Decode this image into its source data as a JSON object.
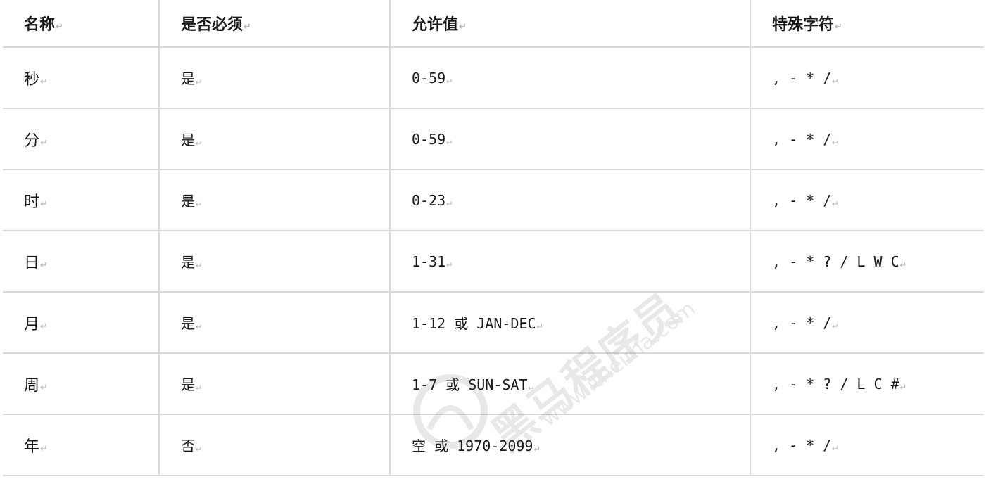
{
  "table": {
    "headers": [
      "名称",
      "是否必须",
      "允许值",
      "特殊字符"
    ],
    "rows": [
      [
        "秒",
        "是",
        "0-59",
        ", - * /"
      ],
      [
        "分",
        "是",
        "0-59",
        ", - * /"
      ],
      [
        "时",
        "是",
        "0-23",
        ", - * /"
      ],
      [
        "日",
        "是",
        "1-31",
        ", - * ? / L W C"
      ],
      [
        "月",
        "是",
        "1-12 或 JAN-DEC",
        ", - * /"
      ],
      [
        "周",
        "是",
        "1-7 或 SUN-SAT",
        ", - * ? / L C #"
      ],
      [
        "年",
        "否",
        "空 或 1970-2099",
        ", - * /"
      ]
    ],
    "cell_mark": "↵"
  },
  "watermark": {
    "brand": "黑马程序员",
    "url": "www.itheima.com",
    "tm": "TM"
  },
  "colors": {
    "border": "#d9d9d9",
    "text": "#1a1a1a",
    "mark": "#b0b0b0"
  }
}
